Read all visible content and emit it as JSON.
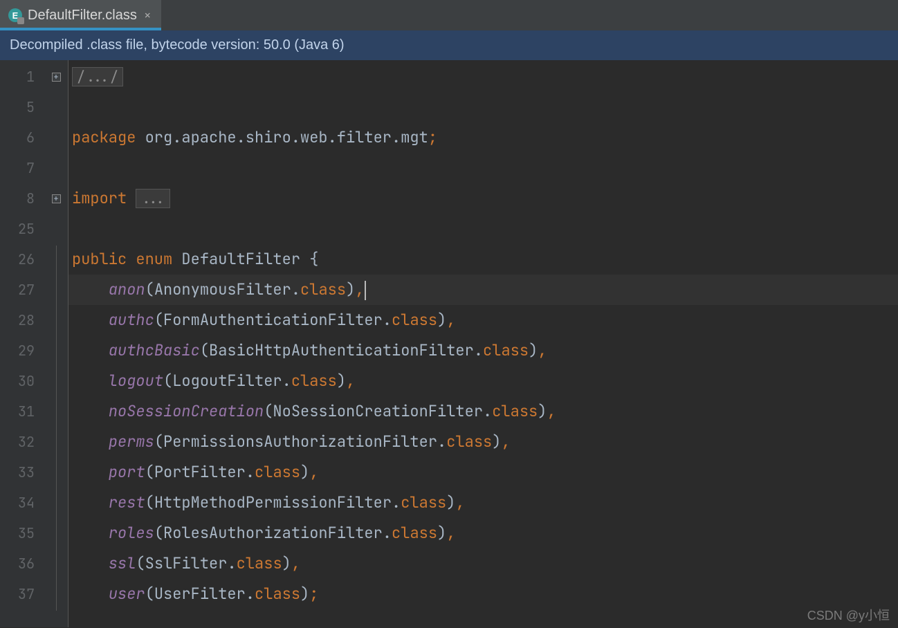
{
  "tab": {
    "label": "DefaultFilter.class",
    "icon_letter": "E",
    "close_glyph": "×"
  },
  "banner": {
    "text": "Decompiled .class file, bytecode version: 50.0 (Java 6)"
  },
  "line_numbers": [
    "1",
    "5",
    "6",
    "7",
    "8",
    "25",
    "26",
    "27",
    "28",
    "29",
    "30",
    "31",
    "32",
    "33",
    "34",
    "35",
    "36",
    "37"
  ],
  "code": {
    "fold_comment": "/.../",
    "fold_import": "...",
    "kw_package": "package",
    "pkg_name": "org.apache.shiro.web.filter.mgt",
    "kw_import": "import",
    "kw_public": "public",
    "kw_enum": "enum",
    "enum_name": "DefaultFilter",
    "brace_open": "{",
    "kw_class": "class",
    "paren_open": "(",
    "paren_close": ")",
    "dot": ".",
    "comma": ",",
    "semicolon": ";",
    "entries": [
      {
        "name": "anon",
        "filter": "AnonymousFilter"
      },
      {
        "name": "authc",
        "filter": "FormAuthenticationFilter"
      },
      {
        "name": "authcBasic",
        "filter": "BasicHttpAuthenticationFilter"
      },
      {
        "name": "logout",
        "filter": "LogoutFilter"
      },
      {
        "name": "noSessionCreation",
        "filter": "NoSessionCreationFilter"
      },
      {
        "name": "perms",
        "filter": "PermissionsAuthorizationFilter"
      },
      {
        "name": "port",
        "filter": "PortFilter"
      },
      {
        "name": "rest",
        "filter": "HttpMethodPermissionFilter"
      },
      {
        "name": "roles",
        "filter": "RolesAuthorizationFilter"
      },
      {
        "name": "ssl",
        "filter": "SslFilter"
      },
      {
        "name": "user",
        "filter": "UserFilter"
      }
    ]
  },
  "current_line_index": 7,
  "watermark": "CSDN @y小恒"
}
